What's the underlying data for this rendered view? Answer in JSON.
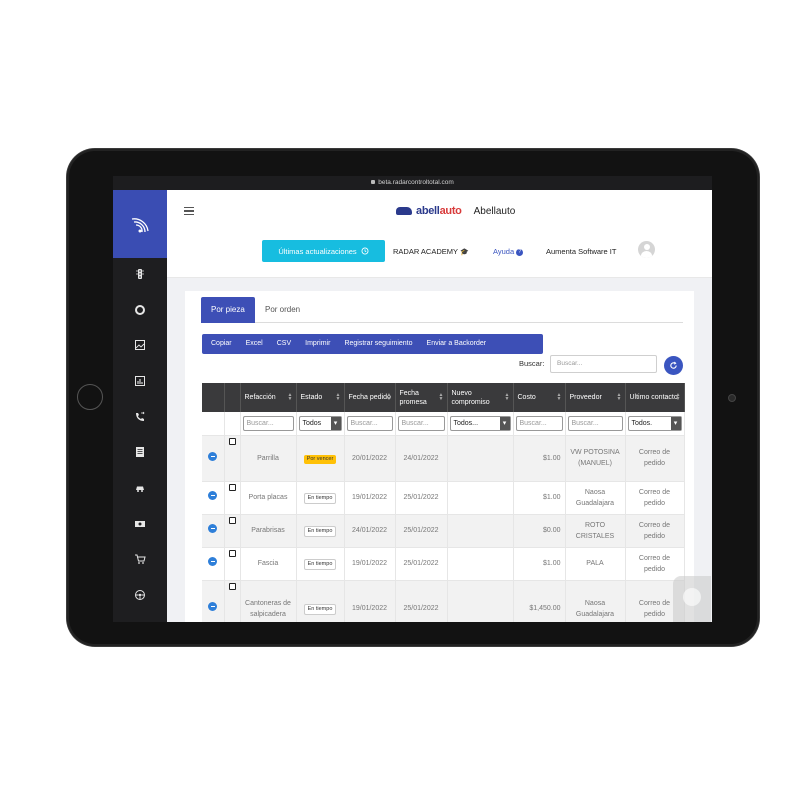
{
  "browser": {
    "url": "beta.radarcontroltotal.com"
  },
  "sidebar": {
    "items": [
      {
        "icon": "traffic-light-icon"
      },
      {
        "icon": "donut-chart-icon"
      },
      {
        "icon": "image-icon"
      },
      {
        "icon": "report-chart-icon"
      },
      {
        "icon": "phone-forward-icon"
      },
      {
        "icon": "document-list-icon"
      },
      {
        "icon": "car-repair-icon"
      },
      {
        "icon": "money-icon"
      },
      {
        "icon": "shopping-cart-icon"
      },
      {
        "icon": "steering-wheel-icon"
      }
    ]
  },
  "header": {
    "brand_logo_main": "abell",
    "brand_logo_accent": "auto",
    "brand_name": "Abellauto",
    "updates_button": "Últimas actualizaciones",
    "academy_label": "RADAR ACADEMY",
    "help_label": "Ayuda",
    "company_label": "Aumenta Software IT"
  },
  "tabs": {
    "active": "Por pieza",
    "inactive": "Por orden"
  },
  "export_buttons": [
    "Copiar",
    "Excel",
    "CSV",
    "Imprimir",
    "Registrar seguimiento",
    "Enviar a Backorder"
  ],
  "search": {
    "label": "Buscar:",
    "placeholder": "Buscar..."
  },
  "table": {
    "columns": [
      {
        "key": "expand",
        "label": ""
      },
      {
        "key": "check",
        "label": ""
      },
      {
        "key": "refaccion",
        "label": "Refacción"
      },
      {
        "key": "estado",
        "label": "Estado"
      },
      {
        "key": "fecha_pedido",
        "label": "Fecha pedido"
      },
      {
        "key": "fecha_promesa",
        "label": "Fecha promesa"
      },
      {
        "key": "nuevo_compromiso",
        "label": "Nuevo compromiso"
      },
      {
        "key": "costo",
        "label": "Costo"
      },
      {
        "key": "proveedor",
        "label": "Proveedor"
      },
      {
        "key": "ultimo_contacto",
        "label": "Ultimo contacto"
      }
    ],
    "filters": {
      "refaccion": "Buscar...",
      "estado": "Todos",
      "fecha_pedido": "Buscar...",
      "fecha_promesa": "Buscar...",
      "nuevo_compromiso": "Todos...",
      "costo": "Buscar...",
      "proveedor": "Buscar...",
      "ultimo_contacto": "Todos."
    },
    "rows": [
      {
        "refaccion": "Parrilla",
        "estado": "Por vencer",
        "estado_type": "warn",
        "fecha_pedido": "20/01/2022",
        "fecha_promesa": "24/01/2022",
        "nuevo_compromiso": "",
        "costo": "$1.00",
        "proveedor": "VW POTOSINA (MANUEL)",
        "ultimo_contacto": "Correo de pedido"
      },
      {
        "refaccion": "Porta placas",
        "estado": "En tiempo",
        "estado_type": "ok",
        "fecha_pedido": "19/01/2022",
        "fecha_promesa": "25/01/2022",
        "nuevo_compromiso": "",
        "costo": "$1.00",
        "proveedor": "Naosa Guadalajara",
        "ultimo_contacto": "Correo de pedido"
      },
      {
        "refaccion": "Parabrisas",
        "estado": "En tiempo",
        "estado_type": "ok",
        "fecha_pedido": "24/01/2022",
        "fecha_promesa": "25/01/2022",
        "nuevo_compromiso": "",
        "costo": "$0.00",
        "proveedor": "ROTO CRISTALES",
        "ultimo_contacto": "Correo de pedido"
      },
      {
        "refaccion": "Fascia",
        "estado": "En tiempo",
        "estado_type": "ok",
        "fecha_pedido": "19/01/2022",
        "fecha_promesa": "25/01/2022",
        "nuevo_compromiso": "",
        "costo": "$1.00",
        "proveedor": "PALA",
        "ultimo_contacto": "Correo de pedido"
      },
      {
        "refaccion": "Cantoneras de salpicadera",
        "estado": "En tiempo",
        "estado_type": "ok",
        "fecha_pedido": "19/01/2022",
        "fecha_promesa": "25/01/2022",
        "nuevo_compromiso": "",
        "costo": "$1,450.00",
        "proveedor": "Naosa Guadalajara",
        "ultimo_contacto": "Correo de pedido"
      }
    ]
  },
  "colors": {
    "primary": "#3d4fb6",
    "accent_cyan": "#17bde0",
    "warning": "#ffc107",
    "sidebar": "#1e1e20"
  }
}
